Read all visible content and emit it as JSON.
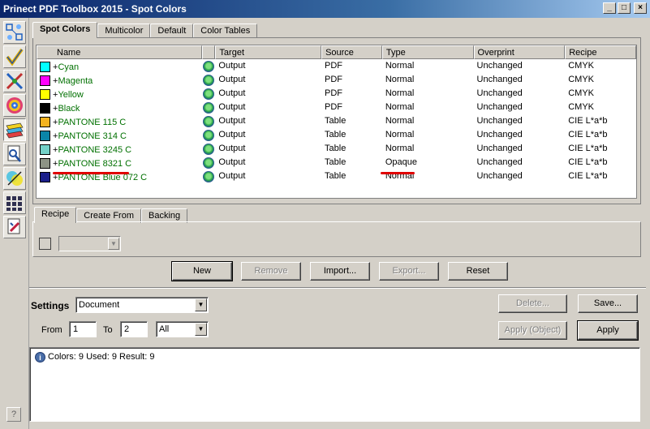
{
  "window": {
    "title": "Prinect PDF Toolbox 2015 - Spot Colors",
    "minimize": "_",
    "maximize": "□",
    "close": "×"
  },
  "top_tabs": [
    {
      "label": "Spot Colors",
      "active": true
    },
    {
      "label": "Multicolor",
      "active": false
    },
    {
      "label": "Default",
      "active": false
    },
    {
      "label": "Color Tables",
      "active": false
    }
  ],
  "columns": {
    "name": "Name",
    "target": "Target",
    "source": "Source",
    "type": "Type",
    "overprint": "Overprint",
    "recipe": "Recipe"
  },
  "rows": [
    {
      "swatch": "#00ffff",
      "plus": "+",
      "name": "Cyan",
      "target": "Output",
      "source": "PDF",
      "type": "Normal",
      "overprint": "Unchanged",
      "recipe": "CMYK"
    },
    {
      "swatch": "#ff00ff",
      "plus": "+",
      "name": "Magenta",
      "target": "Output",
      "source": "PDF",
      "type": "Normal",
      "overprint": "Unchanged",
      "recipe": "CMYK"
    },
    {
      "swatch": "#ffff00",
      "plus": "+",
      "name": "Yellow",
      "target": "Output",
      "source": "PDF",
      "type": "Normal",
      "overprint": "Unchanged",
      "recipe": "CMYK"
    },
    {
      "swatch": "#000000",
      "plus": "+",
      "name": "Black",
      "target": "Output",
      "source": "PDF",
      "type": "Normal",
      "overprint": "Unchanged",
      "recipe": "CMYK"
    },
    {
      "swatch": "#f4b321",
      "plus": "+",
      "name": "PANTONE 115 C",
      "target": "Output",
      "source": "Table",
      "type": "Normal",
      "overprint": "Unchanged",
      "recipe": "CIE L*a*b"
    },
    {
      "swatch": "#0b85a8",
      "plus": "+",
      "name": "PANTONE 314 C",
      "target": "Output",
      "source": "Table",
      "type": "Normal",
      "overprint": "Unchanged",
      "recipe": "CIE L*a*b"
    },
    {
      "swatch": "#74d1c8",
      "plus": "+",
      "name": "PANTONE 3245 C",
      "target": "Output",
      "source": "Table",
      "type": "Normal",
      "overprint": "Unchanged",
      "recipe": "CIE L*a*b"
    },
    {
      "swatch": "#8d9385",
      "plus": "+",
      "name": "PANTONE 8321 C",
      "target": "Output",
      "source": "Table",
      "type": "Opaque",
      "overprint": "Unchanged",
      "recipe": "CIE L*a*b"
    },
    {
      "swatch": "#1b1f8a",
      "plus": "+",
      "name": "PANTONE Blue 072 C",
      "target": "Output",
      "source": "Table",
      "type": "Normal",
      "overprint": "Unchanged",
      "recipe": "CIE L*a*b"
    }
  ],
  "annotation_color": "#e00000",
  "recipe_tabs": [
    {
      "label": "Recipe",
      "active": true
    },
    {
      "label": "Create From",
      "active": false
    },
    {
      "label": "Backing",
      "active": false
    }
  ],
  "buttons": {
    "new": "New",
    "remove": "Remove",
    "import": "Import...",
    "export": "Export...",
    "reset": "Reset",
    "delete": "Delete...",
    "save": "Save...",
    "apply_object": "Apply (Object)",
    "apply": "Apply"
  },
  "settings": {
    "label": "Settings",
    "value": "Document"
  },
  "range": {
    "from_label": "From",
    "from_value": "1",
    "to_label": "To",
    "to_value": "2",
    "pages_value": "All"
  },
  "status": {
    "text": "Colors: 9  Used: 9  Result: 9"
  },
  "help": "?"
}
